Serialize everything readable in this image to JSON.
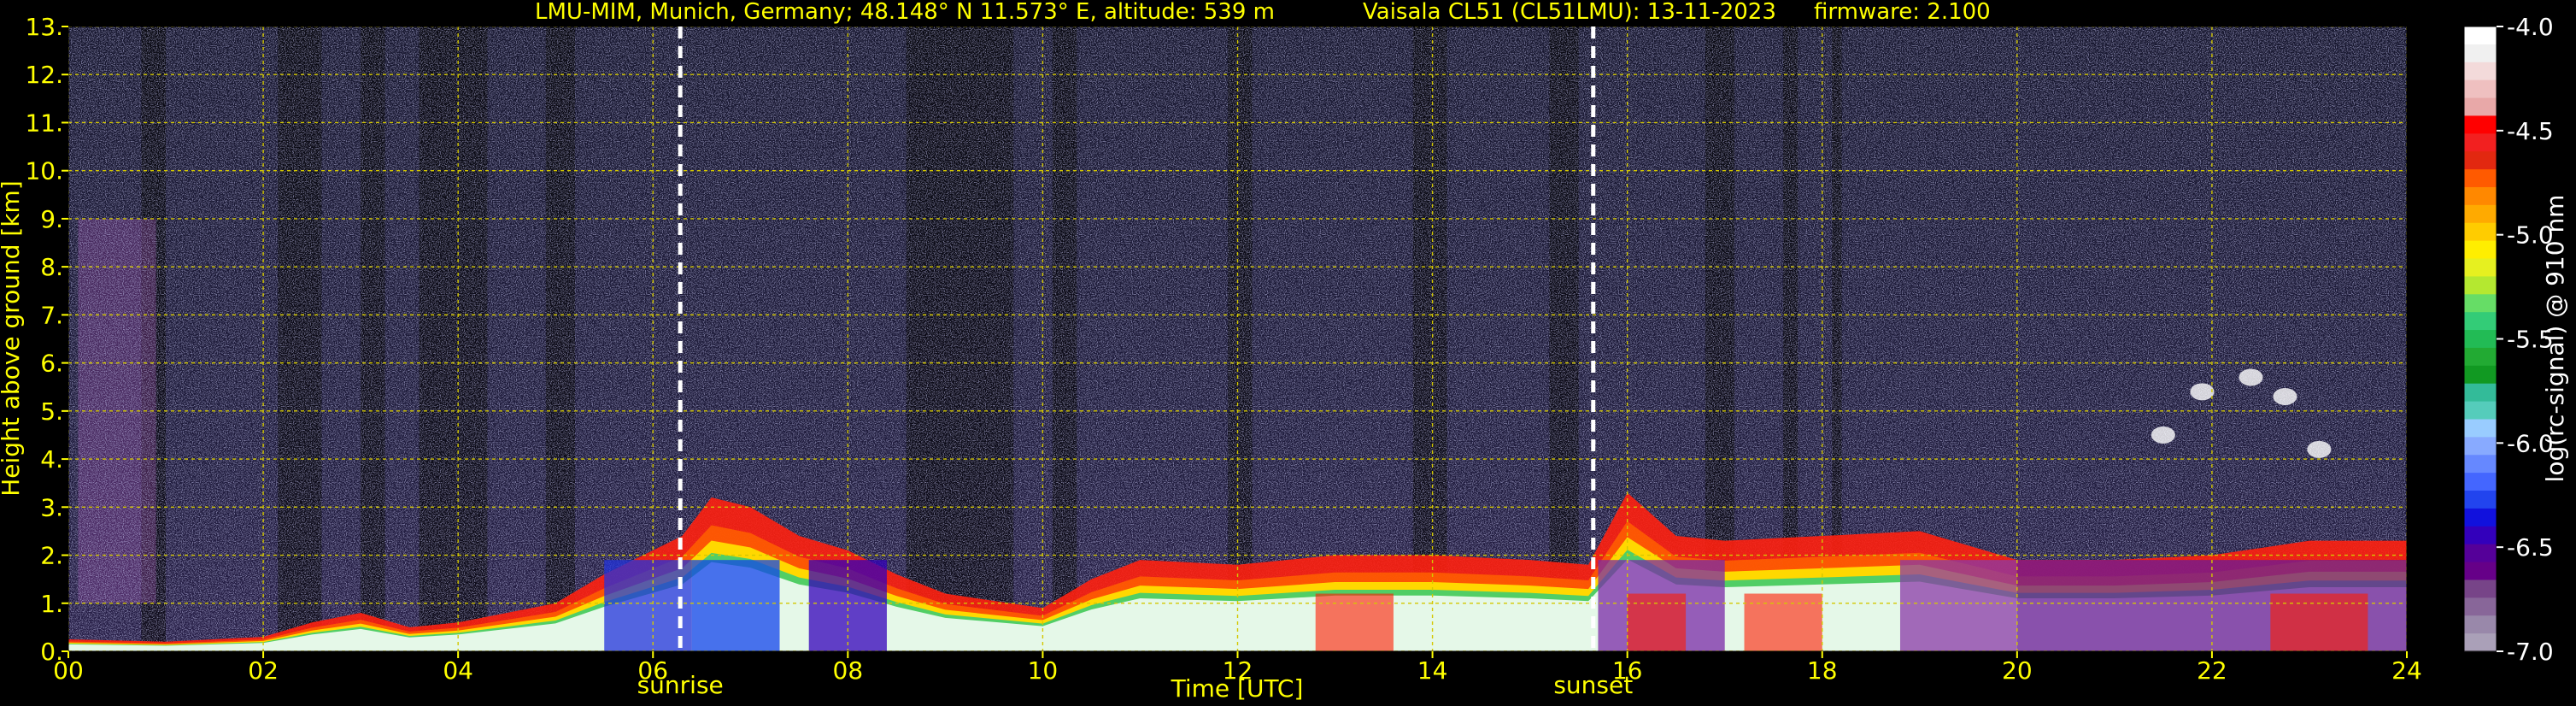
{
  "header": {
    "station": "LMU-MIM, Munich, Germany; 48.148° N 11.573° E, altitude: 539 m",
    "instrument": "Vaisala CL51 (CL51LMU): 13-11-2023",
    "firmware": "firmware: 2.100"
  },
  "colors": {
    "text": "#ffff00",
    "grid": "#d4c800",
    "marker": "#ffffff",
    "background": "#000000"
  },
  "chart_data": {
    "type": "heatmap",
    "xlabel": "Time [UTC]",
    "ylabel": "Height above ground [km]",
    "xlim": [
      0,
      24
    ],
    "ylim": [
      0,
      13
    ],
    "x_ticks": [
      "00",
      "02",
      "04",
      "06",
      "08",
      "10",
      "12",
      "14",
      "16",
      "18",
      "20",
      "22",
      "24"
    ],
    "y_ticks": [
      "0.",
      "1.",
      "2.",
      "3.",
      "4.",
      "5.",
      "6.",
      "7.",
      "8.",
      "9.",
      "10.",
      "11.",
      "12.",
      "13."
    ],
    "grid": true,
    "markers": [
      {
        "label": "sunrise",
        "x": 6.28
      },
      {
        "label": "sunset",
        "x": 15.65
      }
    ],
    "colorbar": {
      "label": "log(rc-signal) @ 910 nm",
      "range": [
        -7.0,
        -4.0
      ],
      "ticks": [
        "-4.0",
        "-4.5",
        "-5.0",
        "-5.5",
        "-6.0",
        "-6.5",
        "-7.0"
      ],
      "colors": [
        "#ffffff",
        "#f0f0f0",
        "#f3dada",
        "#efc0c0",
        "#e8a8a8",
        "#ff0000",
        "#f22020",
        "#e22810",
        "#ff5a00",
        "#ff8800",
        "#ffaa00",
        "#ffcc00",
        "#ffee00",
        "#e6f020",
        "#b4e830",
        "#66dd66",
        "#33cc77",
        "#22bb55",
        "#22aa33",
        "#119922",
        "#33bb99",
        "#55ccbb",
        "#99ccff",
        "#88aaff",
        "#6688ff",
        "#4466ff",
        "#2244ee",
        "#1111dd",
        "#3300bb",
        "#550099",
        "#660088",
        "#774488",
        "#886699",
        "#9988aa",
        "#aaa0b8"
      ]
    },
    "features": {
      "boundary_layer_top_km": [
        [
          0.0,
          0.25
        ],
        [
          1.0,
          0.2
        ],
        [
          2.0,
          0.3
        ],
        [
          2.5,
          0.6
        ],
        [
          3.0,
          0.8
        ],
        [
          3.5,
          0.5
        ],
        [
          4.0,
          0.6
        ],
        [
          5.0,
          1.0
        ],
        [
          5.5,
          1.6
        ],
        [
          6.0,
          2.1
        ],
        [
          6.3,
          2.4
        ],
        [
          6.6,
          3.2
        ],
        [
          7.0,
          3.0
        ],
        [
          7.5,
          2.4
        ],
        [
          8.0,
          2.1
        ],
        [
          8.5,
          1.6
        ],
        [
          9.0,
          1.2
        ],
        [
          10.0,
          0.9
        ],
        [
          10.5,
          1.5
        ],
        [
          11.0,
          1.9
        ],
        [
          12.0,
          1.8
        ],
        [
          13.0,
          2.0
        ],
        [
          14.0,
          2.0
        ],
        [
          15.0,
          1.9
        ],
        [
          15.6,
          1.8
        ],
        [
          16.0,
          3.3
        ],
        [
          16.5,
          2.4
        ],
        [
          17.0,
          2.3
        ],
        [
          18.0,
          2.4
        ],
        [
          19.0,
          2.5
        ],
        [
          20.0,
          1.9
        ],
        [
          21.0,
          1.9
        ],
        [
          22.0,
          2.0
        ],
        [
          23.0,
          2.3
        ],
        [
          24.0,
          2.3
        ]
      ]
    }
  }
}
